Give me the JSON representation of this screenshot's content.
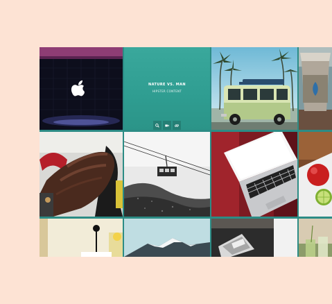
{
  "gallery": {
    "feature_tile": {
      "title": "NATURE VS. MAN",
      "subtitle": "HIPSTER CONTENT",
      "actions": [
        "search-icon",
        "video-icon",
        "link-icon"
      ]
    },
    "tiles": [
      {
        "subject": "apple-logo-icon"
      },
      {
        "subject": "vintage-van"
      },
      {
        "subject": "coffee-cup"
      },
      {
        "subject": "leather-glove-hand"
      },
      {
        "subject": "cable-car"
      },
      {
        "subject": "laptop-keyboard"
      },
      {
        "subject": "tomato-lime"
      },
      {
        "subject": "table-lamp"
      },
      {
        "subject": "snowy-mountain"
      },
      {
        "subject": "smartphone"
      },
      {
        "subject": "drinks"
      }
    ]
  },
  "colors": {
    "page_background": "#fde3d4",
    "accent_teal": "#2f9d91"
  }
}
